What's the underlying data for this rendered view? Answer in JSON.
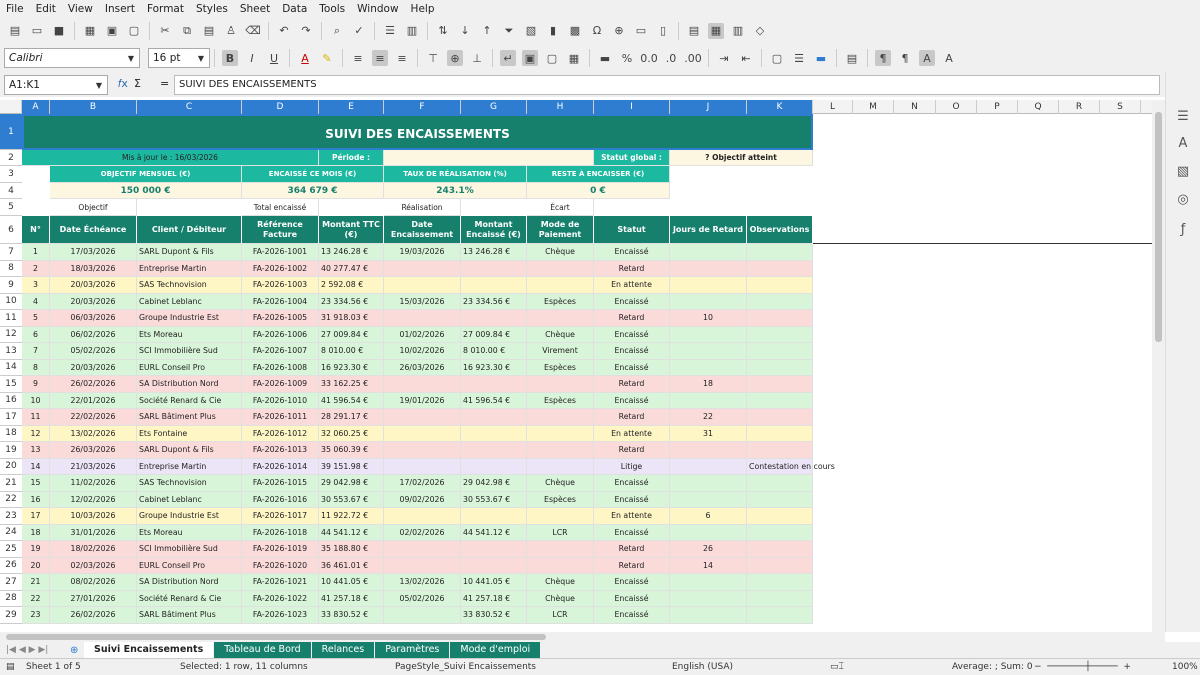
{
  "menu": [
    "File",
    "Edit",
    "View",
    "Insert",
    "Format",
    "Styles",
    "Sheet",
    "Data",
    "Tools",
    "Window",
    "Help"
  ],
  "font": {
    "name": "Calibri",
    "size": "16 pt"
  },
  "namebox": "A1:K1",
  "formula": "SUIVI DES ENCAISSEMENTS",
  "columns": [
    "A",
    "B",
    "C",
    "D",
    "E",
    "F",
    "G",
    "H",
    "I",
    "J",
    "K",
    "L",
    "M",
    "N",
    "O",
    "P",
    "Q",
    "R",
    "S"
  ],
  "colors": {
    "teal": "#17806d",
    "teal2": "#1db8a0",
    "green": "#d9f5d9",
    "red": "#fbdada",
    "yellow": "#fff6c6",
    "purple": "#ece4f7",
    "cream": "#fdf7e1"
  },
  "sheet": {
    "title": "SUIVI DES ENCAISSEMENTS",
    "updated": "Mis à jour le : 16/03/2026",
    "period_label": "Période :",
    "status_label": "Statut global :",
    "status_value": "? Objectif atteint",
    "kpi_headers": [
      "OBJECTIF MENSUEL (€)",
      "ENCAISSÉ CE MOIS (€)",
      "TAUX DE RÉALISATION (%)",
      "RESTE À ENCAISSER (€)"
    ],
    "kpi_values": [
      "150 000 €",
      "364 679 €",
      "243.1%",
      "0 €"
    ],
    "kpi_sub": [
      "Objectif",
      "Total encaissé",
      "Réalisation",
      "Écart"
    ],
    "headers": [
      "N°",
      "Date Échéance",
      "Client / Débiteur",
      "Référence Facture",
      "Montant TTC (€)",
      "Date Encaissement",
      "Montant Encaissé (€)",
      "Mode de Paiement",
      "Statut",
      "Jours de Retard",
      "Observations"
    ],
    "rows": [
      [
        "1",
        "17/03/2026",
        "SARL Dupont & Fils",
        "FA-2026-1001",
        "13 246.28 €",
        "19/03/2026",
        "13 246.28 €",
        "Chèque",
        "Encaissé",
        "",
        ""
      ],
      [
        "2",
        "18/03/2026",
        "Entreprise Martin",
        "FA-2026-1002",
        "40 277.47 €",
        "",
        "",
        "",
        "Retard",
        "",
        ""
      ],
      [
        "3",
        "20/03/2026",
        "SAS Technovision",
        "FA-2026-1003",
        "2 592.08 €",
        "",
        "",
        "",
        "En attente",
        "",
        ""
      ],
      [
        "4",
        "20/03/2026",
        "Cabinet Leblanc",
        "FA-2026-1004",
        "23 334.56 €",
        "15/03/2026",
        "23 334.56 €",
        "Espèces",
        "Encaissé",
        "",
        ""
      ],
      [
        "5",
        "06/03/2026",
        "Groupe Industrie Est",
        "FA-2026-1005",
        "31 918.03 €",
        "",
        "",
        "",
        "Retard",
        "10",
        ""
      ],
      [
        "6",
        "06/02/2026",
        "Ets Moreau",
        "FA-2026-1006",
        "27 009.84 €",
        "01/02/2026",
        "27 009.84 €",
        "Chèque",
        "Encaissé",
        "",
        ""
      ],
      [
        "7",
        "05/02/2026",
        "SCI Immobilière Sud",
        "FA-2026-1007",
        "8 010.00 €",
        "10/02/2026",
        "8 010.00 €",
        "Virement",
        "Encaissé",
        "",
        ""
      ],
      [
        "8",
        "20/03/2026",
        "EURL Conseil Pro",
        "FA-2026-1008",
        "16 923.30 €",
        "26/03/2026",
        "16 923.30 €",
        "Espèces",
        "Encaissé",
        "",
        ""
      ],
      [
        "9",
        "26/02/2026",
        "SA Distribution Nord",
        "FA-2026-1009",
        "33 162.25 €",
        "",
        "",
        "",
        "Retard",
        "18",
        ""
      ],
      [
        "10",
        "22/01/2026",
        "Société Renard & Cie",
        "FA-2026-1010",
        "41 596.54 €",
        "19/01/2026",
        "41 596.54 €",
        "Espèces",
        "Encaissé",
        "",
        ""
      ],
      [
        "11",
        "22/02/2026",
        "SARL Bâtiment Plus",
        "FA-2026-1011",
        "28 291.17 €",
        "",
        "",
        "",
        "Retard",
        "22",
        ""
      ],
      [
        "12",
        "13/02/2026",
        "Ets Fontaine",
        "FA-2026-1012",
        "32 060.25 €",
        "",
        "",
        "",
        "En attente",
        "31",
        ""
      ],
      [
        "13",
        "26/03/2026",
        "SARL Dupont & Fils",
        "FA-2026-1013",
        "35 060.39 €",
        "",
        "",
        "",
        "Retard",
        "",
        ""
      ],
      [
        "14",
        "21/03/2026",
        "Entreprise Martin",
        "FA-2026-1014",
        "39 151.98 €",
        "",
        "",
        "",
        "Litige",
        "",
        "Contestation en cours"
      ],
      [
        "15",
        "11/02/2026",
        "SAS Technovision",
        "FA-2026-1015",
        "29 042.98 €",
        "17/02/2026",
        "29 042.98 €",
        "Chèque",
        "Encaissé",
        "",
        ""
      ],
      [
        "16",
        "12/02/2026",
        "Cabinet Leblanc",
        "FA-2026-1016",
        "30 553.67 €",
        "09/02/2026",
        "30 553.67 €",
        "Espèces",
        "Encaissé",
        "",
        ""
      ],
      [
        "17",
        "10/03/2026",
        "Groupe Industrie Est",
        "FA-2026-1017",
        "11 922.72 €",
        "",
        "",
        "",
        "En attente",
        "6",
        ""
      ],
      [
        "18",
        "31/01/2026",
        "Ets Moreau",
        "FA-2026-1018",
        "44 541.12 €",
        "02/02/2026",
        "44 541.12 €",
        "LCR",
        "Encaissé",
        "",
        ""
      ],
      [
        "19",
        "18/02/2026",
        "SCI Immobilière Sud",
        "FA-2026-1019",
        "35 188.80 €",
        "",
        "",
        "",
        "Retard",
        "26",
        ""
      ],
      [
        "20",
        "02/03/2026",
        "EURL Conseil Pro",
        "FA-2026-1020",
        "36 461.01 €",
        "",
        "",
        "",
        "Retard",
        "14",
        ""
      ],
      [
        "21",
        "08/02/2026",
        "SA Distribution Nord",
        "FA-2026-1021",
        "10 441.05 €",
        "13/02/2026",
        "10 441.05 €",
        "Chèque",
        "Encaissé",
        "",
        ""
      ],
      [
        "22",
        "27/01/2026",
        "Société Renard & Cie",
        "FA-2026-1022",
        "41 257.18 €",
        "05/02/2026",
        "41 257.18 €",
        "Chèque",
        "Encaissé",
        "",
        ""
      ],
      [
        "23",
        "26/02/2026",
        "SARL Bâtiment Plus",
        "FA-2026-1023",
        "33 830.52 €",
        "",
        "33 830.52 €",
        "LCR",
        "Encaissé",
        "",
        ""
      ]
    ]
  },
  "tabs": [
    "Suivi Encaissements",
    "Tableau de Bord",
    "Relances",
    "Paramètres",
    "Mode d'emploi"
  ],
  "status": {
    "sheet": "Sheet 1 of 5",
    "selection": "Selected: 1 row, 11 columns",
    "pagestyle": "PageStyle_Suivi Encaissements",
    "lang": "English (USA)",
    "sum": "Average: ; Sum: 0",
    "zoom": "100%"
  }
}
